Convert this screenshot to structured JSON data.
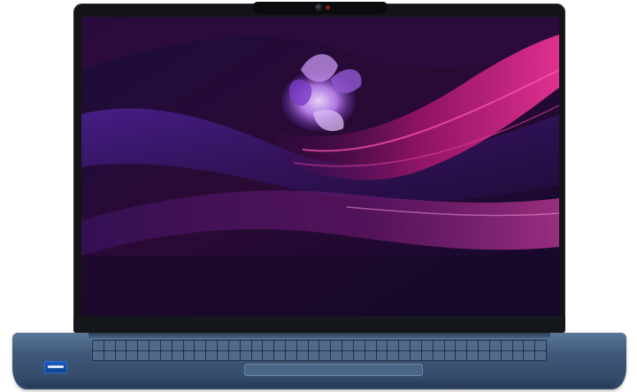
{
  "scene": {
    "subject": "laptop-product-photo",
    "colors": {
      "lid": "#121418",
      "chassis": "#3e5778",
      "keys": "#52698a",
      "wallpaper_base": "#1a0a2e",
      "wallpaper_magenta": "#c2187a",
      "wallpaper_violet": "#6a2fbf",
      "wallpaper_orchid": "#d9b6ff",
      "sticker": "#1d5fbf"
    },
    "icons": [
      "camera-icon",
      "processor-sticker-icon"
    ]
  }
}
